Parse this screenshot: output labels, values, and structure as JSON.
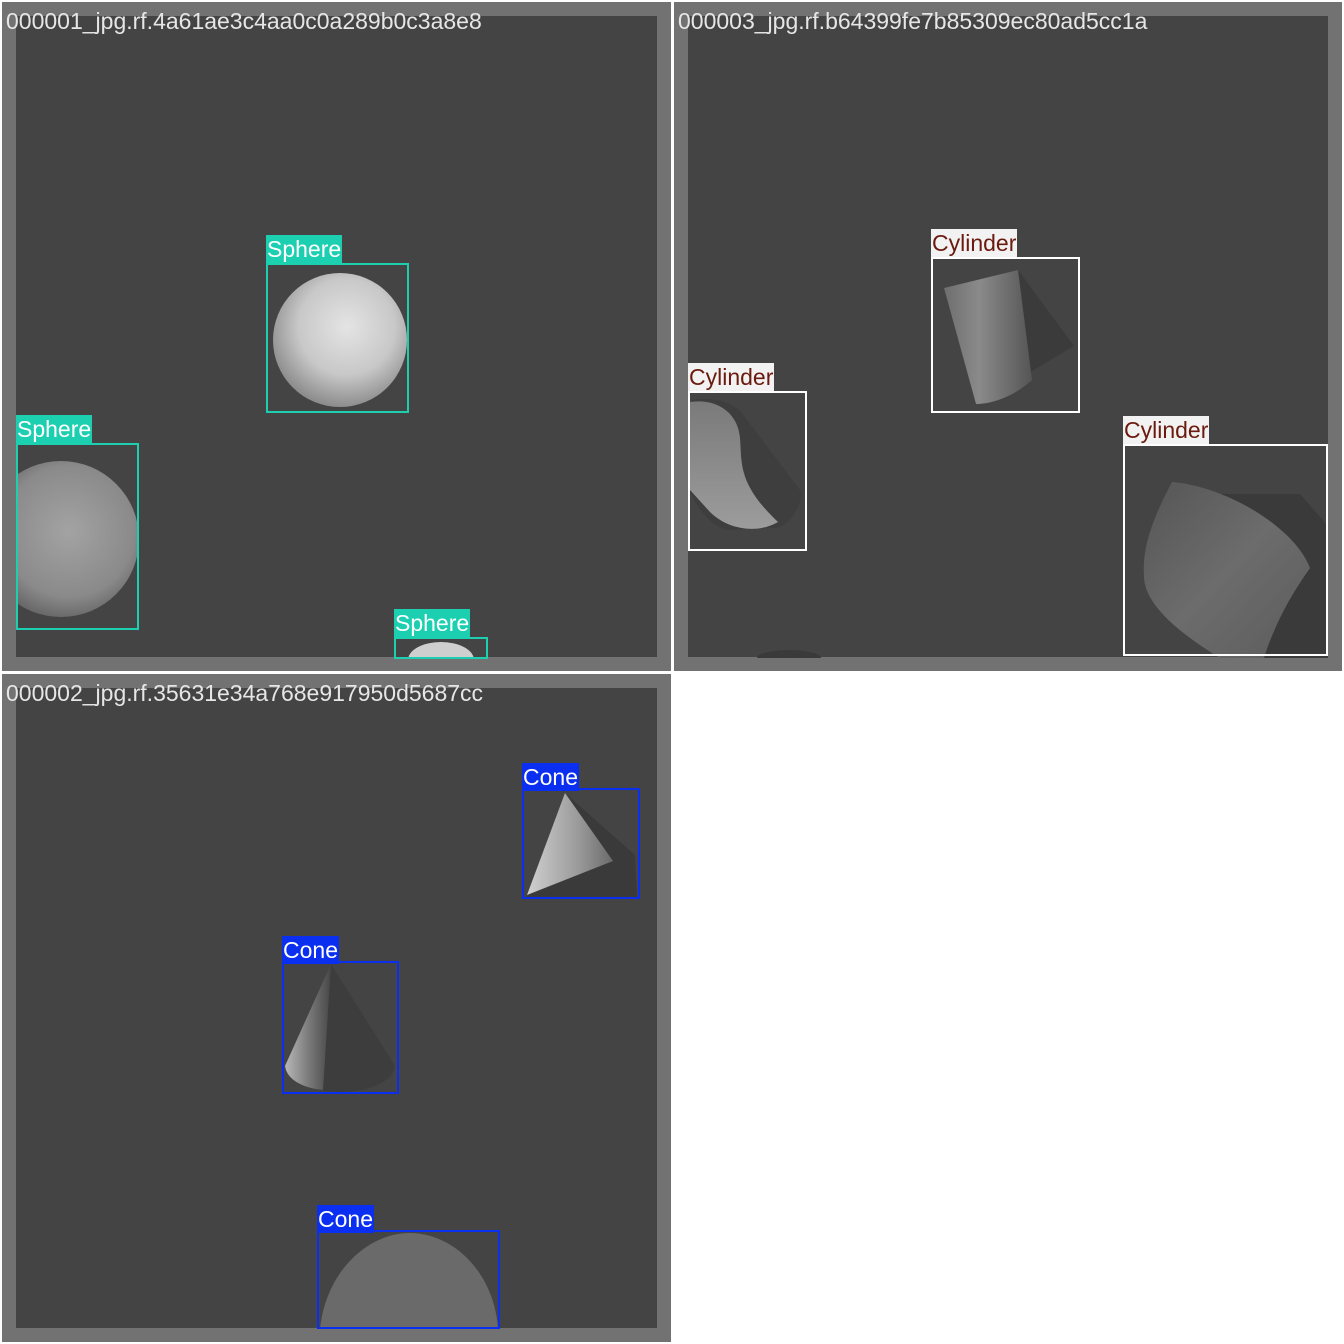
{
  "palette": {
    "sphere": "#1ccfb1",
    "cylinder": "#ffffff",
    "cone": "#0a2ff0",
    "sphere_text": "#ffffff",
    "cylinder_text": "#6b1a0e",
    "cone_text": "#ffffff"
  },
  "tiles": [
    {
      "filename": "000001_jpg.rf.4a61ae3c4aa0c0a289b0c3a8e8",
      "detections": [
        {
          "label": "Sphere"
        },
        {
          "label": "Sphere"
        },
        {
          "label": "Sphere"
        }
      ]
    },
    {
      "filename": "000003_jpg.rf.b64399fe7b85309ec80ad5cc1a",
      "detections": [
        {
          "label": "Cylinder"
        },
        {
          "label": "Cylinder"
        },
        {
          "label": "Cylinder"
        }
      ]
    },
    {
      "filename": "000002_jpg.rf.35631e34a768e917950d5687cc",
      "detections": [
        {
          "label": "Cone"
        },
        {
          "label": "Cone"
        },
        {
          "label": "Cone"
        }
      ]
    }
  ]
}
